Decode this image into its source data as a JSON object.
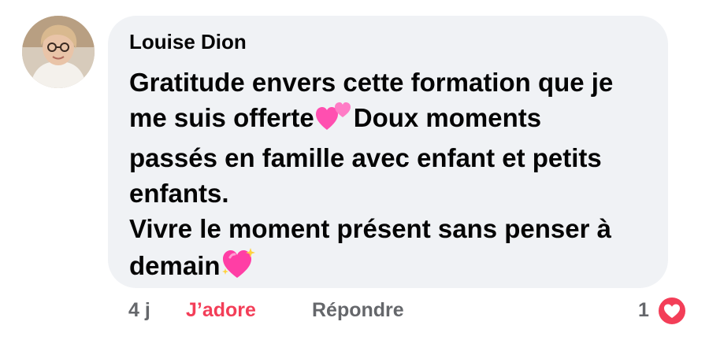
{
  "comment": {
    "author": "Louise Dion",
    "lines": [
      "Gratitude envers cette formation que je",
      "me suis offerte",
      "Doux moments",
      "passés en famille avec enfant et petits",
      "enfants.",
      "Vivre le moment présent sans penser à",
      "demain"
    ],
    "emojis": [
      "two-hearts-emoji",
      "sparkling-heart-emoji"
    ]
  },
  "actions": {
    "time": "4 j",
    "like_label": "J’adore",
    "reply_label": "Répondre",
    "reaction_count": "1",
    "reaction_icon": "love-heart-icon"
  },
  "colors": {
    "bubble": "#f0f2f5",
    "text": "#050505",
    "secondary": "#65676b",
    "love": "#f33e58"
  }
}
